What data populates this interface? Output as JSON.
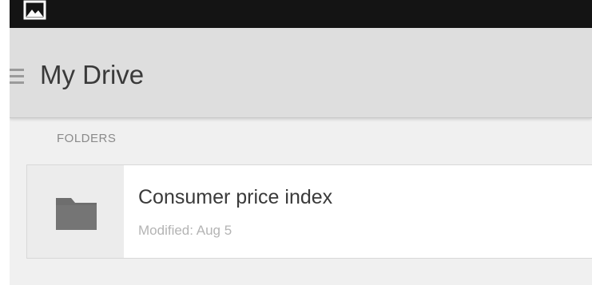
{
  "status_bar": {
    "icon": "image-notification-icon"
  },
  "action_bar": {
    "menu_icon": "hamburger-menu-icon",
    "title": "My Drive"
  },
  "sections": {
    "folders": {
      "label": "FOLDERS",
      "items": [
        {
          "name": "Consumer price index",
          "modified": "Modified: Aug 5",
          "icon": "folder-icon"
        }
      ]
    }
  },
  "colors": {
    "status_bar_bg": "#141414",
    "action_bar_bg": "#dedede",
    "screen_bg": "#f0f0f0",
    "folder_icon": "#6e6e6e"
  }
}
